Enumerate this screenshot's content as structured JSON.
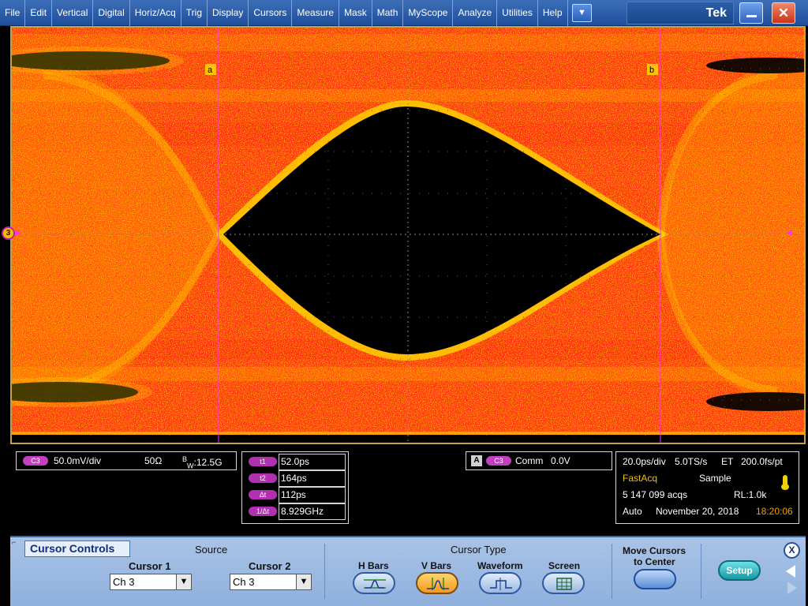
{
  "menu": {
    "items": [
      "File",
      "Edit",
      "Vertical",
      "Digital",
      "Horiz/Acq",
      "Trig",
      "Display",
      "Cursors",
      "Measure",
      "Mask",
      "Math",
      "MyScope",
      "Analyze",
      "Utilities",
      "Help"
    ],
    "dropdown_icon": "chevron-down-icon",
    "brand": "Tek"
  },
  "colors": {
    "eye_hot": "#ff2a10",
    "eye_warm": "#ff7a00",
    "eye_edge": "#ffe000",
    "graticule": "#c4a04a",
    "cursor_line": "#ff30ff",
    "channel": "#c040c0",
    "panel": "#a9c3e6"
  },
  "display": {
    "channel_marker": "3",
    "cursor_a_label": "a",
    "cursor_b_label": "b"
  },
  "channel": {
    "badge": "C3",
    "scale": "50.0mV/div",
    "impedance": "50Ω",
    "bw_prefix": "B",
    "bw_sub": "W",
    "bw_value": ":12.5G"
  },
  "cursors": {
    "rows": [
      {
        "label": "t1",
        "value": "52.0ps"
      },
      {
        "label": "t2",
        "value": "164ps"
      },
      {
        "label": "Δt",
        "value": "112ps"
      },
      {
        "label": "1/Δt",
        "value": "8.929GHz"
      }
    ]
  },
  "trigger": {
    "mode": "A",
    "source": "C3",
    "coupling": "Comm",
    "level": "0.0V"
  },
  "acquisition": {
    "timebase": "20.0ps/div",
    "sample_rate": "5.0TS/s",
    "et": "ET",
    "resolution": "200.0fs/pt",
    "mode": "FastAcq",
    "sample": "Sample",
    "acqs": "5 147 099 acqs",
    "record_length": "RL:1.0k",
    "trigger_mode": "Auto",
    "date": "November 20, 2018",
    "time": "18:20:06"
  },
  "panel": {
    "title": "Cursor Controls",
    "source_label": "Source",
    "cursor1_label": "Cursor 1",
    "cursor1_value": "Ch 3",
    "cursor2_label": "Cursor 2",
    "cursor2_value": "Ch 3",
    "cursor_type_label": "Cursor Type",
    "types": [
      "H Bars",
      "V Bars",
      "Waveform",
      "Screen"
    ],
    "active_type": "V Bars",
    "move_center_label_1": "Move Cursors",
    "move_center_label_2": "to Center",
    "setup_label": "Setup",
    "close_label": "X"
  }
}
